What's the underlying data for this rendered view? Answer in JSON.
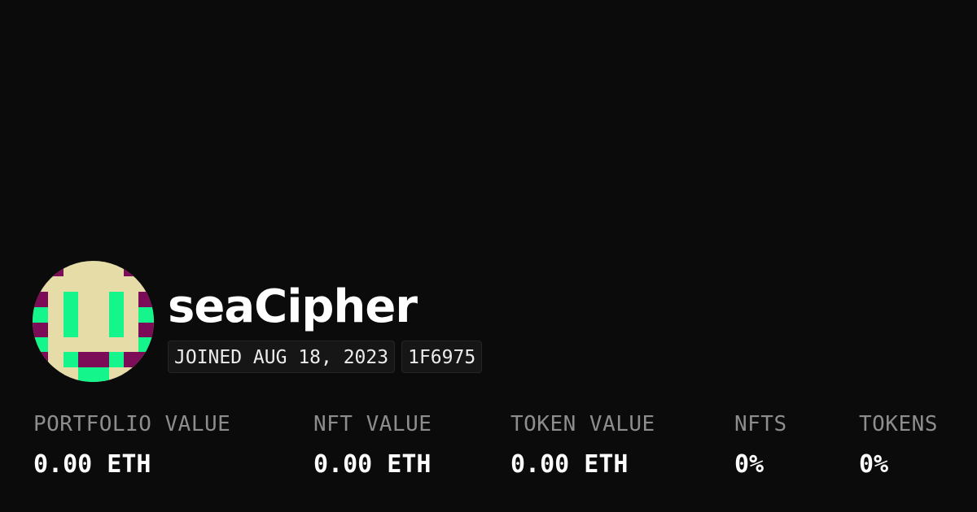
{
  "profile": {
    "username": "seaCipher",
    "joined": "JOINED AUG 18, 2023",
    "color_code": "1F6975",
    "avatar": {
      "icon": "pixel-smiley-avatar",
      "colors": {
        "face": "#e6dca8",
        "accent_green": "#14f58c",
        "accent_purple": "#7c0c57"
      }
    }
  },
  "stats": [
    {
      "label": "PORTFOLIO VALUE",
      "value": "0.00 ETH"
    },
    {
      "label": "NFT VALUE",
      "value": "0.00 ETH"
    },
    {
      "label": "TOKEN VALUE",
      "value": "0.00 ETH"
    },
    {
      "label": "NFTS",
      "value": "0%"
    },
    {
      "label": "TOKENS",
      "value": "0%"
    }
  ],
  "theme": {
    "background": "#0b0b0b",
    "text_primary": "#ffffff",
    "text_muted": "#8d8d8d"
  }
}
